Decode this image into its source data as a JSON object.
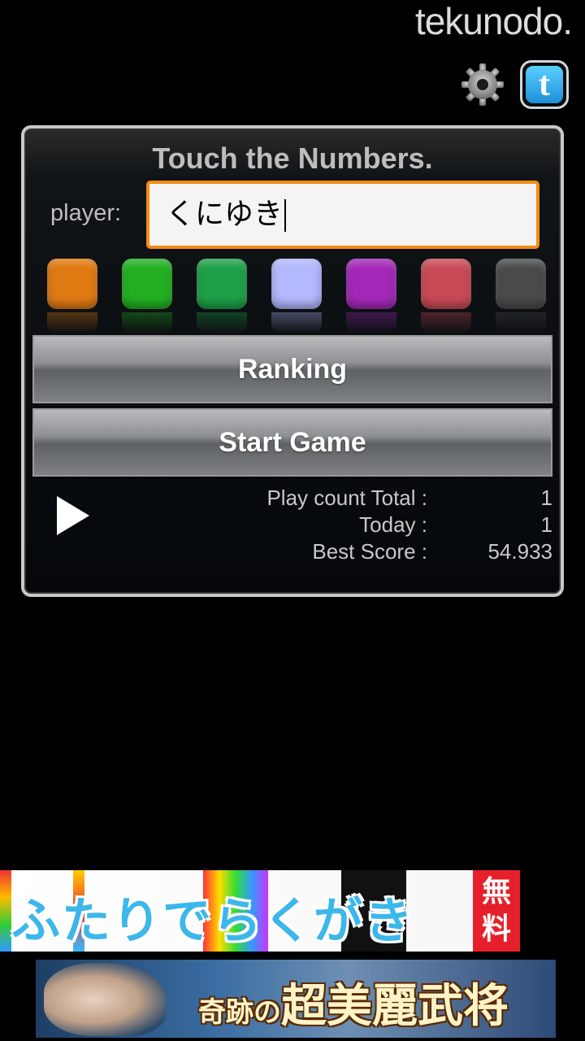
{
  "header": {
    "brand": "tekunodo.",
    "settings_icon": "gear-icon",
    "twitter_icon": "twitter-icon",
    "twitter_glyph": "t"
  },
  "panel": {
    "title": "Touch the Numbers.",
    "player_label": "player:",
    "player_value": "くにゆき",
    "color_swatches": [
      "#e07a12",
      "#22b022",
      "#1ea048",
      "#b4b8ff",
      "#a328b8",
      "#c84a55",
      "#4a4a4a"
    ],
    "ranking_label": "Ranking",
    "start_label": "Start Game",
    "play_icon": "play-icon",
    "stats": {
      "total_label": "Play count Total :",
      "total_value": "1",
      "today_label": "Today :",
      "today_value": "1",
      "best_label": "Best Score :",
      "best_value": "54.933"
    }
  },
  "ads": {
    "banner1_text": "ふたりでらくがき",
    "banner1_badge_line1": "無",
    "banner1_badge_line2": "料",
    "banner2_prefix": "奇跡の",
    "banner2_text": "超美麗武将"
  }
}
